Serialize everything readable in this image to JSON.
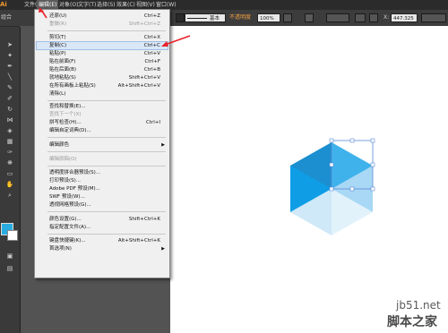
{
  "menubar": {
    "logo": "Ai",
    "items": [
      "文件(F)",
      "编辑(E)",
      "对象(O)",
      "文字(T)",
      "选择(S)",
      "效果(C)",
      "视图(V)",
      "窗口(W)"
    ]
  },
  "controlbar": {
    "left_label": "组合",
    "stroke_style": "基本",
    "opacity_label": "不透明度",
    "opacity_value": "100%",
    "x_label": "X:",
    "x_value": "447.325"
  },
  "menu": {
    "rows": [
      {
        "label": "还原(U)",
        "shortcut": "Ctrl+Z",
        "disabled": false
      },
      {
        "label": "重做(R)",
        "shortcut": "Shift+Ctrl+Z",
        "disabled": true
      },
      {
        "label": "剪切(T)",
        "shortcut": "Ctrl+X",
        "disabled": false
      },
      {
        "label": "复制(C)",
        "shortcut": "Ctrl+C",
        "disabled": false
      },
      {
        "label": "粘贴(P)",
        "shortcut": "Ctrl+V",
        "disabled": false
      },
      {
        "label": "贴在前面(F)",
        "shortcut": "Ctrl+F",
        "disabled": false
      },
      {
        "label": "贴在后面(B)",
        "shortcut": "Ctrl+B",
        "disabled": false
      },
      {
        "label": "就地粘贴(S)",
        "shortcut": "Shift+Ctrl+V",
        "disabled": false
      },
      {
        "label": "在所有画板上粘贴(S)",
        "shortcut": "Alt+Shift+Ctrl+V",
        "disabled": false
      },
      {
        "label": "清除(L)",
        "shortcut": "",
        "disabled": false
      },
      {
        "label": "查找和替换(E)...",
        "shortcut": "",
        "disabled": false
      },
      {
        "label": "查找下一个(X)",
        "shortcut": "",
        "disabled": true
      },
      {
        "label": "拼写检查(H)...",
        "shortcut": "Ctrl+I",
        "disabled": false
      },
      {
        "label": "编辑自定词典(D)...",
        "shortcut": "",
        "disabled": false
      },
      {
        "label": "编辑颜色",
        "shortcut": "",
        "disabled": false
      },
      {
        "label": "编辑原稿(O)",
        "shortcut": "",
        "disabled": true
      },
      {
        "label": "透明度拼合器预设(S)...",
        "shortcut": "",
        "disabled": false
      },
      {
        "label": "打印预设(S)...",
        "shortcut": "",
        "disabled": false
      },
      {
        "label": "Adobe PDF 预设(M)...",
        "shortcut": "",
        "disabled": false
      },
      {
        "label": "SWF 预设(W)...",
        "shortcut": "",
        "disabled": false
      },
      {
        "label": "透视网格预设(G)...",
        "shortcut": "",
        "disabled": false
      },
      {
        "label": "颜色设置(G)...",
        "shortcut": "Shift+Ctrl+K",
        "disabled": false
      },
      {
        "label": "指定配置文件(A)...",
        "shortcut": "",
        "disabled": false
      },
      {
        "label": "键盘快捷键(K)...",
        "shortcut": "Alt+Shift+Ctrl+K",
        "disabled": false
      },
      {
        "label": "首选项(N)",
        "shortcut": "",
        "disabled": false
      }
    ]
  },
  "hexagon": {
    "colors": {
      "top_left": "#1c8fd0",
      "top_right": "#3fb2ec",
      "mid_left": "#0f9ee6",
      "mid_right": "#a8d8f5",
      "bottom_left": "#cfe9f8",
      "bottom_right": "#e2f2fb",
      "selection": "#5a8ad8"
    }
  },
  "watermark": {
    "line1": "jb51.net",
    "line2": "脚本之家"
  },
  "colors": {
    "fill": "#29abe2",
    "stroke": "#ffffff",
    "accent": "#e8232a"
  }
}
